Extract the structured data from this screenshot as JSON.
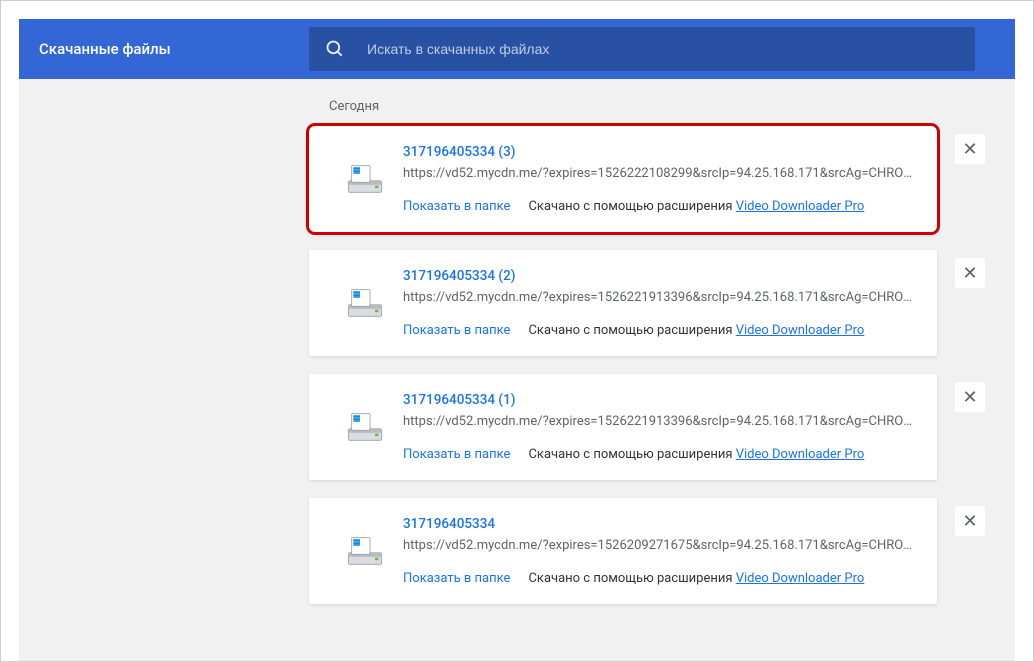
{
  "header": {
    "title": "Скачанные файлы",
    "search_placeholder": "Искать в скачанных файлах"
  },
  "date_label": "Сегодня",
  "labels": {
    "show_in_folder": "Показать в папке",
    "downloaded_with": "Скачано с помощью расширения",
    "extension_name": "Video Downloader Pro"
  },
  "downloads": [
    {
      "title": "317196405334 (3)",
      "url": "https://vd52.mycdn.me/?expires=1526222108299&srcIp=94.25.168.171&srcAg=CHROM...",
      "highlighted": true
    },
    {
      "title": "317196405334 (2)",
      "url": "https://vd52.mycdn.me/?expires=1526221913396&srcIp=94.25.168.171&srcAg=CHROM...",
      "highlighted": false
    },
    {
      "title": "317196405334 (1)",
      "url": "https://vd52.mycdn.me/?expires=1526221913396&srcIp=94.25.168.171&srcAg=CHROM...",
      "highlighted": false
    },
    {
      "title": "317196405334",
      "url": "https://vd52.mycdn.me/?expires=1526209271675&srcIp=94.25.168.171&srcAg=CHROM...",
      "highlighted": false
    }
  ]
}
